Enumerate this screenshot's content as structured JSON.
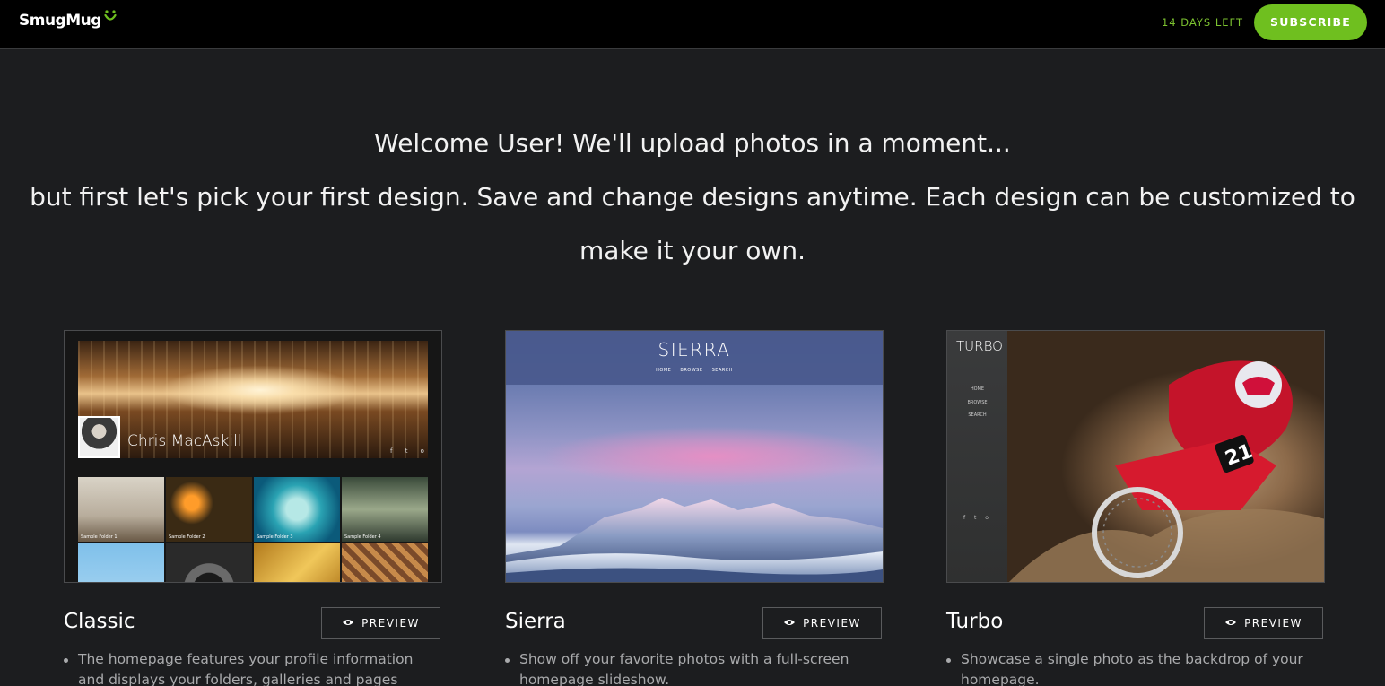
{
  "header": {
    "logo_text": "SmugMug",
    "days_left": "14 DAYS LEFT",
    "subscribe_label": "SUBSCRIBE"
  },
  "welcome": {
    "line1": "Welcome User! We'll upload photos in a moment...",
    "line2": "but first let's pick your first design. Save and change designs anytime. Each design can be customized to",
    "line3": "make it your own."
  },
  "designs": [
    {
      "name": "Classic",
      "preview_label": "PREVIEW",
      "description": "The homepage features your profile information and displays your folders, galleries and pages below.",
      "thumb": {
        "name": "Chris MacAskill",
        "folders": [
          "Sample Folder 1",
          "Sample Folder 2",
          "Sample Folder 3",
          "Sample Folder 4"
        ]
      }
    },
    {
      "name": "Sierra",
      "preview_label": "PREVIEW",
      "description": "Show off your favorite photos with a full-screen homepage slideshow.",
      "thumb": {
        "title": "SIERRA",
        "nav": "HOME BROWSE SEARCH"
      }
    },
    {
      "name": "Turbo",
      "preview_label": "PREVIEW",
      "description": "Showcase a single photo as the backdrop of your homepage.",
      "thumb": {
        "title": "TURBO",
        "nav": [
          "HOME",
          "BROWSE",
          "SEARCH"
        ]
      }
    }
  ],
  "colors": {
    "accent_green": "#6fbf1f",
    "days_left_green": "#7cc230",
    "background": "#1c1d1f",
    "topbar": "#000000"
  }
}
